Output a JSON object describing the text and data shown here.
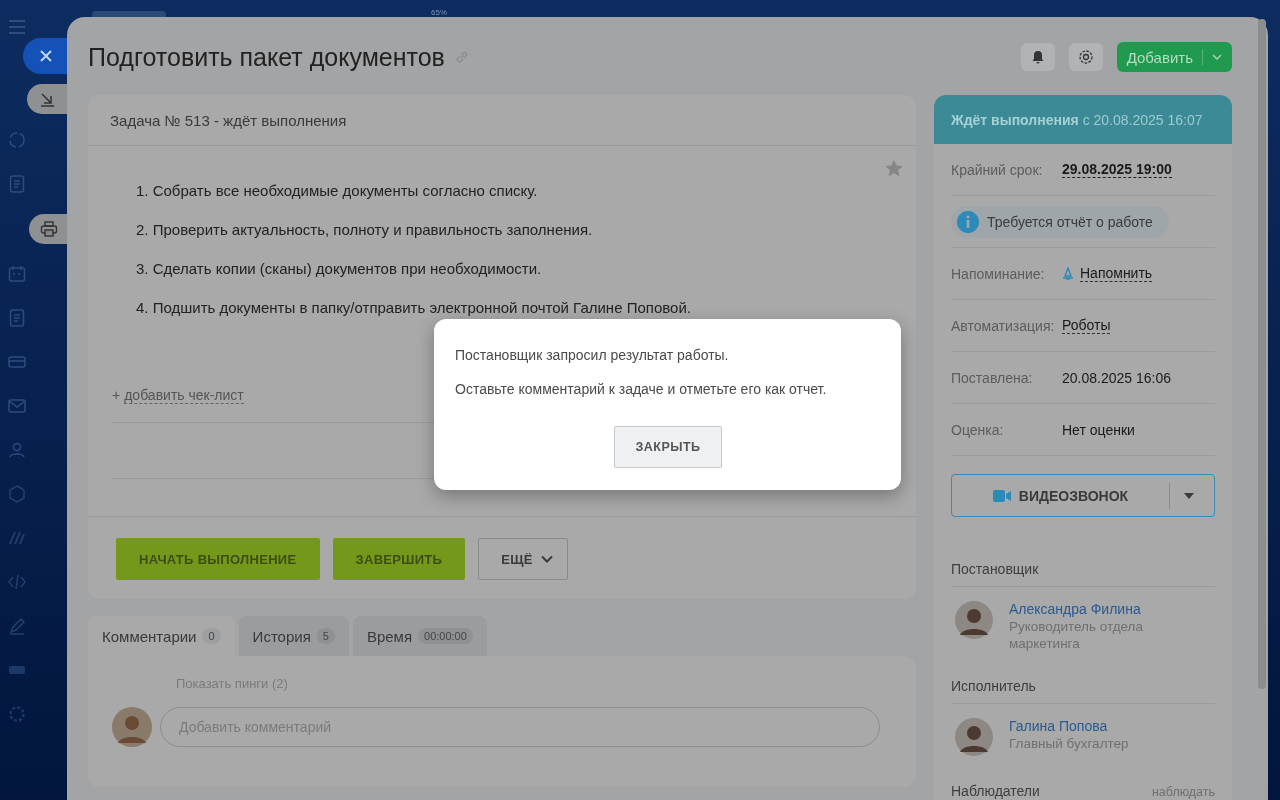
{
  "top_indicator": "65%",
  "title": "Подготовить пакет документов",
  "add_button": "Добавить",
  "task": {
    "heading": "Задача № 513 - ждёт выполнения",
    "steps": [
      "1. Собрать все необходимые документы согласно списку.",
      "2. Проверить актуальность, полноту и правильность заполнения.",
      "3. Сделать копии (сканы) документов при необходимости.",
      "4. Подшить документы в папку/отправить электронной почтой Галине Поповой."
    ],
    "add_prefix": "+",
    "add_checklist": "добавить чек-лист"
  },
  "actions": [
    {
      "label": "НАЧАТЬ ВЫПОЛНЕНИЕ",
      "kind": "primary"
    },
    {
      "label": "ЗАВЕРШИТЬ",
      "kind": "primary"
    },
    {
      "label": "ЕЩЁ",
      "kind": "menu"
    }
  ],
  "tabs": [
    {
      "label": "Комментарии",
      "count": "0",
      "selected": true
    },
    {
      "label": "История",
      "count": "5",
      "selected": false
    },
    {
      "label": "Время",
      "count": "00:00:00",
      "selected": false
    }
  ],
  "comments": {
    "pings": "Показать пинги (2)",
    "placeholder": "Добавить комментарий"
  },
  "status": {
    "state": "Ждёт выполнения",
    "since": "с 20.08.2025 16:07"
  },
  "details": [
    {
      "kind": "deadline",
      "label": "Крайний срок:",
      "value": "29.08.2025 19:00"
    },
    {
      "kind": "notice",
      "value": "Требуется отчёт о работе"
    },
    {
      "kind": "reminder",
      "label": "Напоминание:",
      "value": "Напомнить"
    },
    {
      "kind": "link",
      "label": "Автоматизация:",
      "value": "Роботы"
    },
    {
      "kind": "plain",
      "label": "Поставлена:",
      "value": "20.08.2025 16:06"
    },
    {
      "kind": "plain",
      "label": "Оценка:",
      "value": "Нет оценки"
    }
  ],
  "video_call": "ВИДЕОЗВОНОК",
  "people": [
    {
      "role": "Постановщик",
      "name": "Александра Филина",
      "position": "Руководитель отдела маркетинга"
    },
    {
      "role": "Исполнитель",
      "name": "Галина Попова",
      "position": "Главный бухгалтер"
    }
  ],
  "observers": {
    "role": "Наблюдатели",
    "action": "наблюдать"
  },
  "dialog": {
    "lines": [
      "Постановщик запросил результат работы.",
      "Оставьте комментарий к задаче и отметьте его как отчет."
    ],
    "button": "ЗАКРЫТЬ"
  }
}
